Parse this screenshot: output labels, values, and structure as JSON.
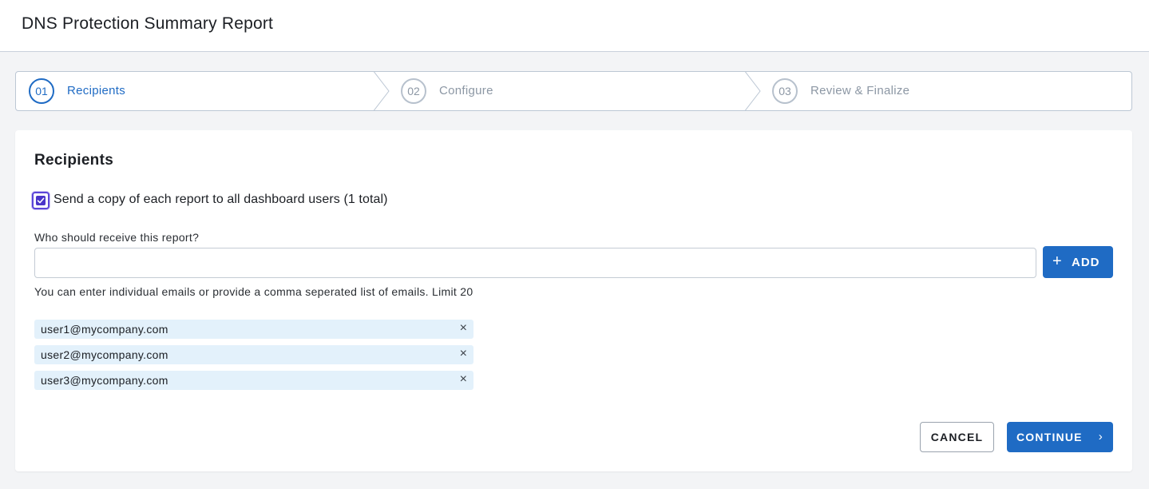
{
  "header": {
    "title": "DNS Protection Summary Report"
  },
  "stepper": {
    "steps": [
      {
        "number": "01",
        "label": "Recipients",
        "active": true
      },
      {
        "number": "02",
        "label": "Configure",
        "active": false
      },
      {
        "number": "03",
        "label": "Review & Finalize",
        "active": false
      }
    ]
  },
  "card": {
    "title": "Recipients",
    "copy_checkbox": {
      "label": "Send a copy of each report to all dashboard users (1 total)",
      "checked": true
    },
    "recipient_field": {
      "label": "Who should receive this report?",
      "value": "",
      "placeholder": "",
      "help": "You can enter individual emails or provide a comma seperated list of emails. Limit 20"
    },
    "add_button": {
      "icon": "plus-icon",
      "label": "ADD"
    },
    "recipients": [
      {
        "email": "user1@mycompany.com"
      },
      {
        "email": "user2@mycompany.com"
      },
      {
        "email": "user3@mycompany.com"
      }
    ],
    "remove_icon": "×",
    "cancel_label": "CANCEL",
    "continue_label": "CONTINUE",
    "continue_icon": "›"
  },
  "colors": {
    "accent": "#1f6bc4",
    "checkbox": "#4a35c9",
    "chip_bg": "#e3f1fb",
    "page_bg": "#f3f4f6"
  }
}
